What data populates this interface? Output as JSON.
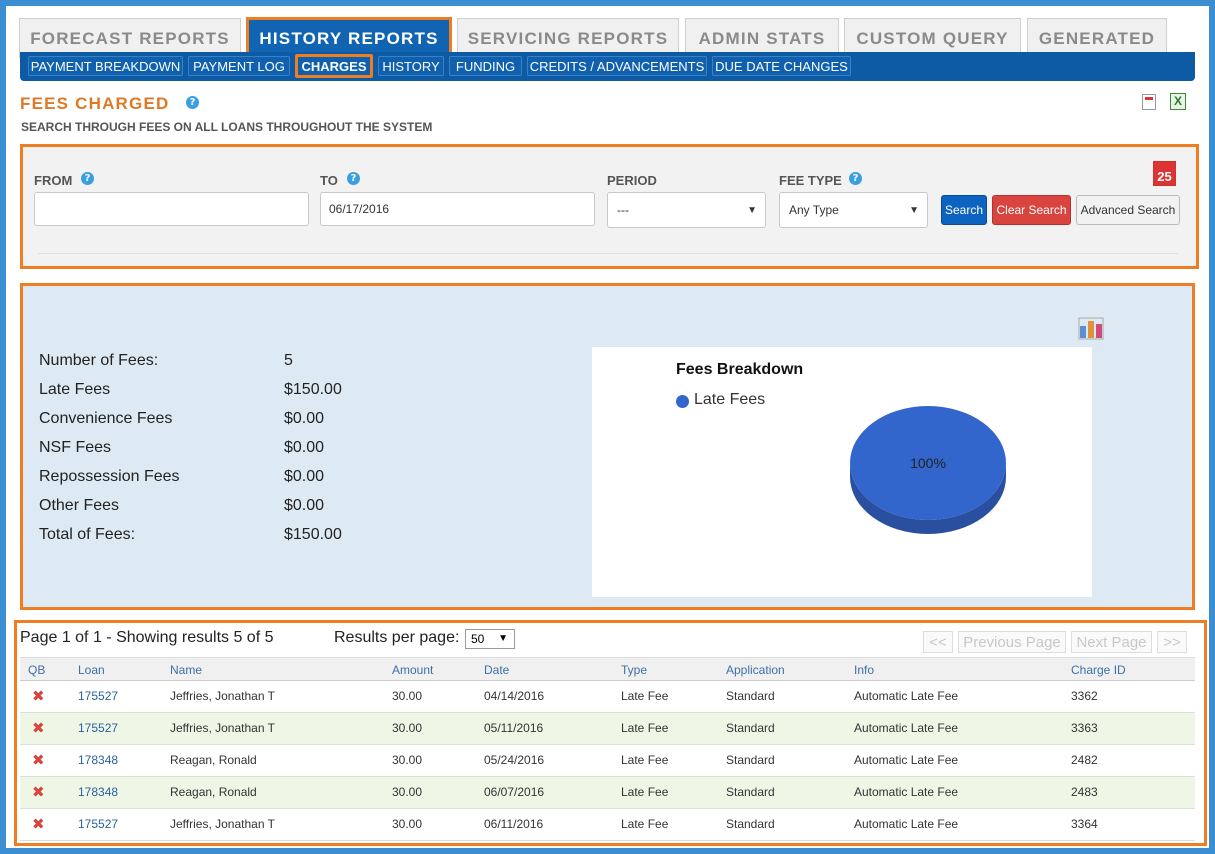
{
  "top_tabs": [
    {
      "label": "FORECAST REPORTS",
      "active": false
    },
    {
      "label": "HISTORY REPORTS",
      "active": true
    },
    {
      "label": "SERVICING REPORTS",
      "active": false
    },
    {
      "label": "ADMIN STATS",
      "active": false
    },
    {
      "label": "CUSTOM QUERY",
      "active": false
    },
    {
      "label": "GENERATED",
      "active": false
    }
  ],
  "sub_tabs": [
    {
      "label": "PAYMENT BREAKDOWN"
    },
    {
      "label": "PAYMENT LOG"
    },
    {
      "label": "CHARGES",
      "active": true
    },
    {
      "label": "HISTORY"
    },
    {
      "label": "FUNDING"
    },
    {
      "label": "CREDITS / ADVANCEMENTS"
    },
    {
      "label": "DUE DATE CHANGES"
    }
  ],
  "page": {
    "title": "FEES CHARGED",
    "subtitle": "SEARCH THROUGH FEES ON ALL LOANS THROUGHOUT THE SYSTEM"
  },
  "search": {
    "from_label": "FROM",
    "from_value": "",
    "to_label": "TO",
    "to_value": "06/17/2016",
    "period_label": "PERIOD",
    "period_value": "---",
    "fee_type_label": "FEE TYPE",
    "fee_type_value": "Any Type",
    "search_button": "Search",
    "clear_button": "Clear Search",
    "advanced_button": "Advanced Search",
    "calendar_day": "25"
  },
  "summary": {
    "stats": [
      {
        "label": "Number of Fees:",
        "value": "5"
      },
      {
        "label": "Late Fees",
        "value": "$150.00"
      },
      {
        "label": "Convenience Fees",
        "value": "$0.00"
      },
      {
        "label": "NSF Fees",
        "value": "$0.00"
      },
      {
        "label": "Repossession Fees",
        "value": "$0.00"
      },
      {
        "label": "Other Fees",
        "value": "$0.00"
      },
      {
        "label": "Total of Fees:",
        "value": "$150.00"
      }
    ]
  },
  "chart_data": {
    "type": "pie",
    "title": "Fees Breakdown",
    "categories": [
      "Late Fees"
    ],
    "values": [
      100
    ],
    "value_labels": [
      "100%"
    ],
    "legend": "top-left",
    "colors": [
      "#3366cc"
    ]
  },
  "results": {
    "page_info": "Page 1 of 1 - Showing results 5 of 5",
    "rpp_label": "Results per page:",
    "rpp_value": "50",
    "pager": {
      "first": "<<",
      "prev": "Previous Page",
      "next": "Next Page",
      "last": ">>"
    },
    "columns": [
      "QB",
      "Loan",
      "Name",
      "Amount",
      "Date",
      "Type",
      "Application",
      "Info",
      "Charge ID"
    ],
    "rows": [
      {
        "loan": "175527",
        "name": "Jeffries, Jonathan T",
        "amount": "30.00",
        "date": "04/14/2016",
        "type": "Late Fee",
        "application": "Standard",
        "info": "Automatic Late Fee",
        "charge_id": "3362"
      },
      {
        "loan": "175527",
        "name": "Jeffries, Jonathan T",
        "amount": "30.00",
        "date": "05/11/2016",
        "type": "Late Fee",
        "application": "Standard",
        "info": "Automatic Late Fee",
        "charge_id": "3363"
      },
      {
        "loan": "178348",
        "name": "Reagan, Ronald",
        "amount": "30.00",
        "date": "05/24/2016",
        "type": "Late Fee",
        "application": "Standard",
        "info": "Automatic Late Fee",
        "charge_id": "2482"
      },
      {
        "loan": "178348",
        "name": "Reagan, Ronald",
        "amount": "30.00",
        "date": "06/07/2016",
        "type": "Late Fee",
        "application": "Standard",
        "info": "Automatic Late Fee",
        "charge_id": "2483"
      },
      {
        "loan": "175527",
        "name": "Jeffries, Jonathan T",
        "amount": "30.00",
        "date": "06/11/2016",
        "type": "Late Fee",
        "application": "Standard",
        "info": "Automatic Late Fee",
        "charge_id": "3364"
      }
    ]
  },
  "colors": {
    "accent_orange": "#ef7d22",
    "nav_blue": "#0d5aa5",
    "pie_blue": "#3366cc"
  }
}
